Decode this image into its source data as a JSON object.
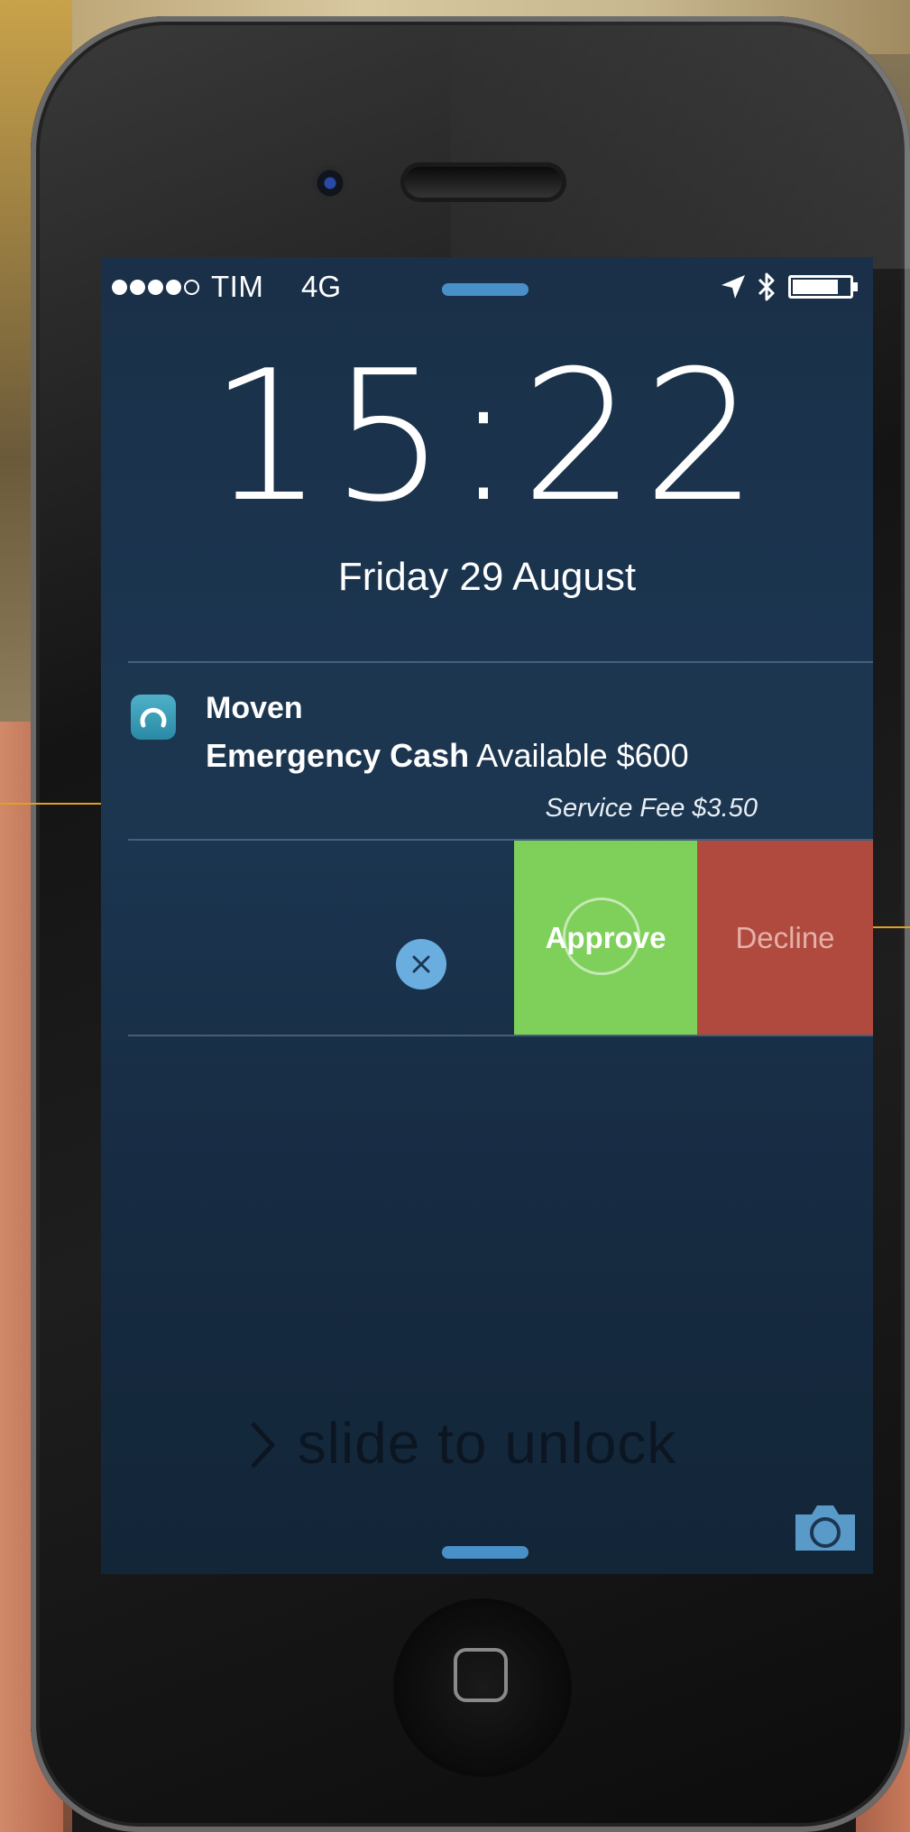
{
  "status_bar": {
    "carrier": "TIM",
    "network": "4G",
    "signal_bars_filled": 4,
    "signal_bars_total": 5,
    "battery_level": 0.8
  },
  "lock_screen": {
    "time": "15:22",
    "date": "Friday 29 August",
    "unlock_text": "slide to unlock"
  },
  "notification": {
    "app_name": "Moven",
    "title": "Emergency Cash",
    "message": "Available $600",
    "fee": "Service Fee $3.50",
    "icon_color": "#3a9ab8"
  },
  "actions": {
    "approve_label": "Approve",
    "decline_label": "Decline",
    "approve_color": "#7ed05a",
    "decline_color": "#b04a3e"
  },
  "icons": {
    "location": "location-arrow-icon",
    "bluetooth": "bluetooth-icon",
    "battery": "battery-icon",
    "dismiss": "close-icon",
    "camera": "camera-icon",
    "chevron": "chevron-right-icon"
  }
}
